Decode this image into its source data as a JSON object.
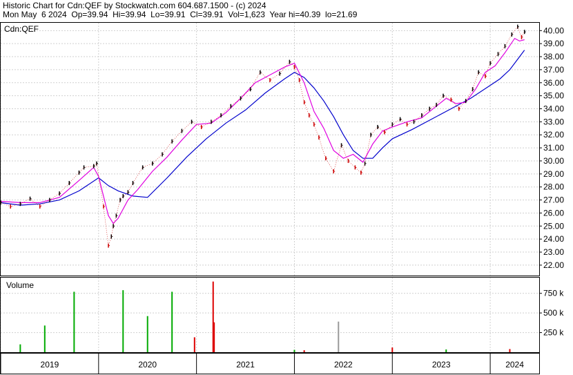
{
  "header": {
    "line1": "Historic Chart for Cdn:QEF by Stockwatch.com 604.687.1500 - (c) 2024",
    "line2": "Mon May  6 2024  Op=39.94  Hi=39.94  Lo=39.91  Cl=39.91  Vol=1,623  Year hi=40.39  lo=21.69"
  },
  "colors": {
    "price_up": "#000000",
    "price_down": "#cc0000",
    "ma_short": "#e000e0",
    "ma_long": "#0000cc",
    "vol_up": "#00aa00",
    "vol_down": "#dd0000",
    "vol_neutral": "#999999"
  },
  "chart_data": [
    {
      "type": "line",
      "title": "Cdn:QEF",
      "price_axis": {
        "ylim": [
          21.2,
          40.6
        ],
        "ticks": [
          "40.00",
          "39.00",
          "38.00",
          "37.00",
          "36.00",
          "35.00",
          "34.00",
          "33.00",
          "32.00",
          "31.00",
          "30.00",
          "29.00",
          "28.00",
          "27.00",
          "26.00",
          "25.00",
          "24.00",
          "23.00",
          "22.00"
        ]
      },
      "x_axis": {
        "xlim": [
          2019.0,
          2024.5
        ],
        "year_labels": [
          "2019",
          "2020",
          "2021",
          "2022",
          "2023",
          "2024"
        ],
        "year_boundaries": [
          2019.0,
          2020.0,
          2021.0,
          2022.0,
          2023.0,
          2024.0
        ]
      },
      "grid": true,
      "series": [
        {
          "role": "price",
          "x": [
            2019.0,
            2019.1,
            2019.2,
            2019.3,
            2019.4,
            2019.5,
            2019.6,
            2019.7,
            2019.8,
            2019.85,
            2019.95,
            2019.98,
            2020.05,
            2020.1,
            2020.13,
            2020.15,
            2020.18,
            2020.22,
            2020.25,
            2020.3,
            2020.35,
            2020.45,
            2020.55,
            2020.65,
            2020.75,
            2020.85,
            2020.95,
            2021.05,
            2021.15,
            2021.25,
            2021.35,
            2021.45,
            2021.55,
            2021.65,
            2021.75,
            2021.85,
            2021.95,
            2022.0,
            2022.05,
            2022.1,
            2022.15,
            2022.2,
            2022.25,
            2022.32,
            2022.4,
            2022.48,
            2022.55,
            2022.62,
            2022.68,
            2022.72,
            2022.78,
            2022.85,
            2022.92,
            2023.0,
            2023.08,
            2023.15,
            2023.22,
            2023.3,
            2023.38,
            2023.45,
            2023.52,
            2023.6,
            2023.68,
            2023.75,
            2023.82,
            2023.88,
            2023.95,
            2024.0,
            2024.08,
            2024.15,
            2024.22,
            2024.28,
            2024.32,
            2024.35
          ],
          "values": [
            26.8,
            26.5,
            26.7,
            27.1,
            26.5,
            27.0,
            27.5,
            28.3,
            29.1,
            29.5,
            29.6,
            29.8,
            26.5,
            23.5,
            24.2,
            25.0,
            25.8,
            27.0,
            27.3,
            27.6,
            28.3,
            29.5,
            29.8,
            30.5,
            31.5,
            32.3,
            33.0,
            32.6,
            33.0,
            33.5,
            34.2,
            34.8,
            35.5,
            36.8,
            36.2,
            36.7,
            37.6,
            37.2,
            36.2,
            34.5,
            33.5,
            32.8,
            31.8,
            30.2,
            29.2,
            31.2,
            30.0,
            29.5,
            29.1,
            29.8,
            32.0,
            32.6,
            32.2,
            32.8,
            33.2,
            32.8,
            33.0,
            33.5,
            34.0,
            34.3,
            35.0,
            34.7,
            34.0,
            34.6,
            35.5,
            36.8,
            36.5,
            37.5,
            38.2,
            38.8,
            39.7,
            40.3,
            39.5,
            39.9
          ]
        },
        {
          "role": "moving_average_short",
          "x": [
            2019.0,
            2019.2,
            2019.4,
            2019.6,
            2019.8,
            2019.95,
            2020.0,
            2020.1,
            2020.15,
            2020.2,
            2020.3,
            2020.4,
            2020.55,
            2020.7,
            2020.85,
            2021.0,
            2021.15,
            2021.3,
            2021.45,
            2021.6,
            2021.75,
            2021.9,
            2022.0,
            2022.1,
            2022.2,
            2022.3,
            2022.4,
            2022.5,
            2022.6,
            2022.7,
            2022.8,
            2022.9,
            2023.0,
            2023.15,
            2023.3,
            2023.45,
            2023.55,
            2023.65,
            2023.75,
            2023.85,
            2023.95,
            2024.05,
            2024.15,
            2024.25,
            2024.3,
            2024.35
          ],
          "values": [
            26.9,
            26.8,
            26.8,
            27.2,
            28.5,
            29.5,
            28.8,
            25.8,
            25.2,
            25.6,
            27.0,
            27.8,
            29.2,
            30.3,
            31.6,
            32.8,
            32.9,
            33.7,
            34.8,
            36.0,
            36.6,
            37.2,
            37.5,
            36.0,
            33.8,
            32.5,
            30.8,
            30.2,
            30.5,
            29.9,
            31.3,
            32.3,
            32.6,
            33.0,
            33.3,
            34.2,
            34.8,
            34.4,
            34.5,
            35.5,
            36.8,
            37.3,
            38.3,
            39.4,
            39.2,
            39.3
          ]
        },
        {
          "role": "moving_average_long",
          "x": [
            2019.0,
            2019.2,
            2019.4,
            2019.6,
            2019.8,
            2020.0,
            2020.1,
            2020.2,
            2020.35,
            2020.5,
            2020.7,
            2020.9,
            2021.1,
            2021.3,
            2021.5,
            2021.7,
            2021.9,
            2022.0,
            2022.1,
            2022.2,
            2022.3,
            2022.4,
            2022.5,
            2022.6,
            2022.7,
            2022.8,
            2022.9,
            2023.0,
            2023.2,
            2023.4,
            2023.6,
            2023.8,
            2024.0,
            2024.1,
            2024.2,
            2024.3,
            2024.35
          ],
          "values": [
            26.8,
            26.6,
            26.7,
            27.0,
            27.7,
            28.7,
            28.1,
            27.7,
            27.3,
            27.2,
            28.7,
            30.3,
            31.7,
            32.9,
            33.9,
            35.2,
            36.3,
            36.8,
            36.4,
            35.6,
            34.6,
            33.4,
            32.0,
            30.8,
            30.2,
            30.2,
            31.0,
            31.7,
            32.4,
            33.2,
            34.0,
            34.8,
            35.8,
            36.3,
            37.0,
            38.0,
            38.5
          ]
        }
      ]
    },
    {
      "type": "bar",
      "title": "Volume",
      "y_axis": {
        "ylim": [
          0,
          950
        ],
        "ticks": [
          "750 k",
          "500 k",
          "250 k"
        ],
        "tick_values": [
          750,
          500,
          250
        ]
      },
      "bars": [
        {
          "x": 2019.2,
          "value": 100,
          "dir": "up"
        },
        {
          "x": 2019.45,
          "value": 340,
          "dir": "up"
        },
        {
          "x": 2019.75,
          "value": 770,
          "dir": "up"
        },
        {
          "x": 2020.25,
          "value": 790,
          "dir": "up"
        },
        {
          "x": 2020.5,
          "value": 460,
          "dir": "up"
        },
        {
          "x": 2020.75,
          "value": 770,
          "dir": "up"
        },
        {
          "x": 2020.98,
          "value": 190,
          "dir": "down"
        },
        {
          "x": 2021.17,
          "value": 900,
          "dir": "down"
        },
        {
          "x": 2021.18,
          "value": 380,
          "dir": "down"
        },
        {
          "x": 2022.0,
          "value": 30,
          "dir": "up"
        },
        {
          "x": 2022.1,
          "value": 25,
          "dir": "down"
        },
        {
          "x": 2022.45,
          "value": 390,
          "dir": "neutral"
        },
        {
          "x": 2023.0,
          "value": 60,
          "dir": "down"
        },
        {
          "x": 2023.55,
          "value": 35,
          "dir": "up"
        },
        {
          "x": 2024.2,
          "value": 40,
          "dir": "down"
        }
      ]
    }
  ]
}
